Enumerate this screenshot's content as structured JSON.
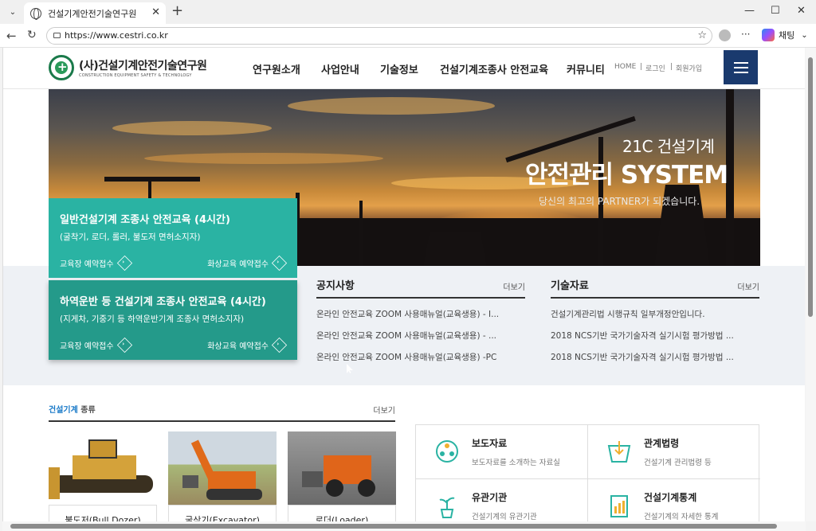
{
  "browser": {
    "tab_title": "건설기계안전기술연구원",
    "url": "https://www.cestri.co.kr",
    "chat_label": "채팅"
  },
  "site": {
    "logo_name": "(사)건설기계안전기술연구원",
    "logo_sub": "CONSTRUCTION EQUIPMENT SAFETY & TECHNOLOGY",
    "nav": [
      "연구원소개",
      "사업안내",
      "기술정보",
      "건설기계조종사 안전교육",
      "커뮤니티"
    ],
    "util": [
      "HOME",
      "로그인",
      "회원가입"
    ]
  },
  "hero": {
    "line1": "21C 건설기계",
    "line2": "안전관리 SYSTEM",
    "line3": "당신의 최고의 PARTNER가 되겠습니다."
  },
  "courses": [
    {
      "title": "일반건설기계 조종사 안전교육 (4시간)",
      "desc": "(굴착기, 로더, 롤러, 불도저 면허소지자)",
      "link1": "교육장 예약접수",
      "link2": "화상교육 예약접수"
    },
    {
      "title": "하역운반 등 건설기계 조종사 안전교육 (4시간)",
      "desc": "(지게차, 기중기 등 하역운반기계 조종사 면허소지자)",
      "link1": "교육장 예약접수",
      "link2": "화상교육 예약접수"
    }
  ],
  "notice": {
    "title": "공지사항",
    "more": "더보기",
    "items": [
      "온라인 안전교육 ZOOM 사용매뉴얼(교육생용) - I...",
      "온라인 안전교육 ZOOM 사용매뉴얼(교육생용) - ...",
      "온라인 안전교육 ZOOM 사용매뉴얼(교육생용) -PC"
    ]
  },
  "tech": {
    "title": "기술자료",
    "more": "더보기",
    "items": [
      "건설기계관리법 시행규칙 일부개정안입니다.",
      "2018 NCS기반 국가기술자격 실기시험 평가방법 ...",
      "2018 NCS기반 국가기술자격 실기시험 평가방법 ..."
    ]
  },
  "types": {
    "title_hl": "건설기계",
    "title_rest": " 종류",
    "more": "더보기",
    "items": [
      "불도저(Bull Dozer)",
      "굴삭기(Excavator)",
      "로더(Loader)"
    ]
  },
  "quick": [
    {
      "title": "보도자료",
      "desc": "보도자료를 소개하는 자료실"
    },
    {
      "title": "관계법령",
      "desc": "건설기계 관리법령 등"
    },
    {
      "title": "유관기관",
      "desc": "건설기계의 유관기관"
    },
    {
      "title": "건설기계통계",
      "desc": "건설기계의 자세한 통계"
    }
  ],
  "colors": {
    "teal": "#2ab3a3",
    "navy": "#1a3a6e",
    "accent_blue": "#1a7ac8"
  }
}
